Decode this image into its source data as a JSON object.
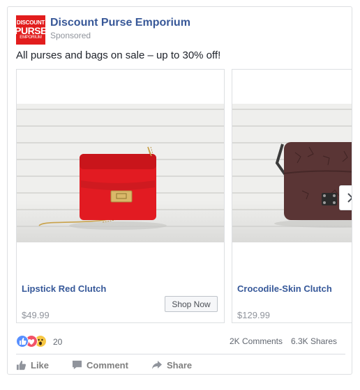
{
  "post": {
    "logo": {
      "line1": "DISCOUNT",
      "line2": "PURSE",
      "line3": "EMPORIUM"
    },
    "page_name": "Discount Purse Emporium",
    "sponsored": "Sponsored",
    "text": "All purses and bags on sale – up to 30% off!"
  },
  "carousel": {
    "items": [
      {
        "title": "Lipstick Red Clutch",
        "price": "$49.99",
        "button": "Shop Now",
        "bag_color": "#e21b22"
      },
      {
        "title": "Crocodile-Skin Clutch",
        "price": "$129.99",
        "bag_color": "#5a3535"
      }
    ],
    "next_icon": "chevron-right-icon"
  },
  "stats": {
    "reaction_count": "20",
    "comments": "2K Comments",
    "shares": "6.3K Shares"
  },
  "actions": {
    "like": "Like",
    "comment": "Comment",
    "share": "Share"
  },
  "colors": {
    "link": "#385898",
    "muted": "#90949c",
    "border": "#dddfe2"
  }
}
